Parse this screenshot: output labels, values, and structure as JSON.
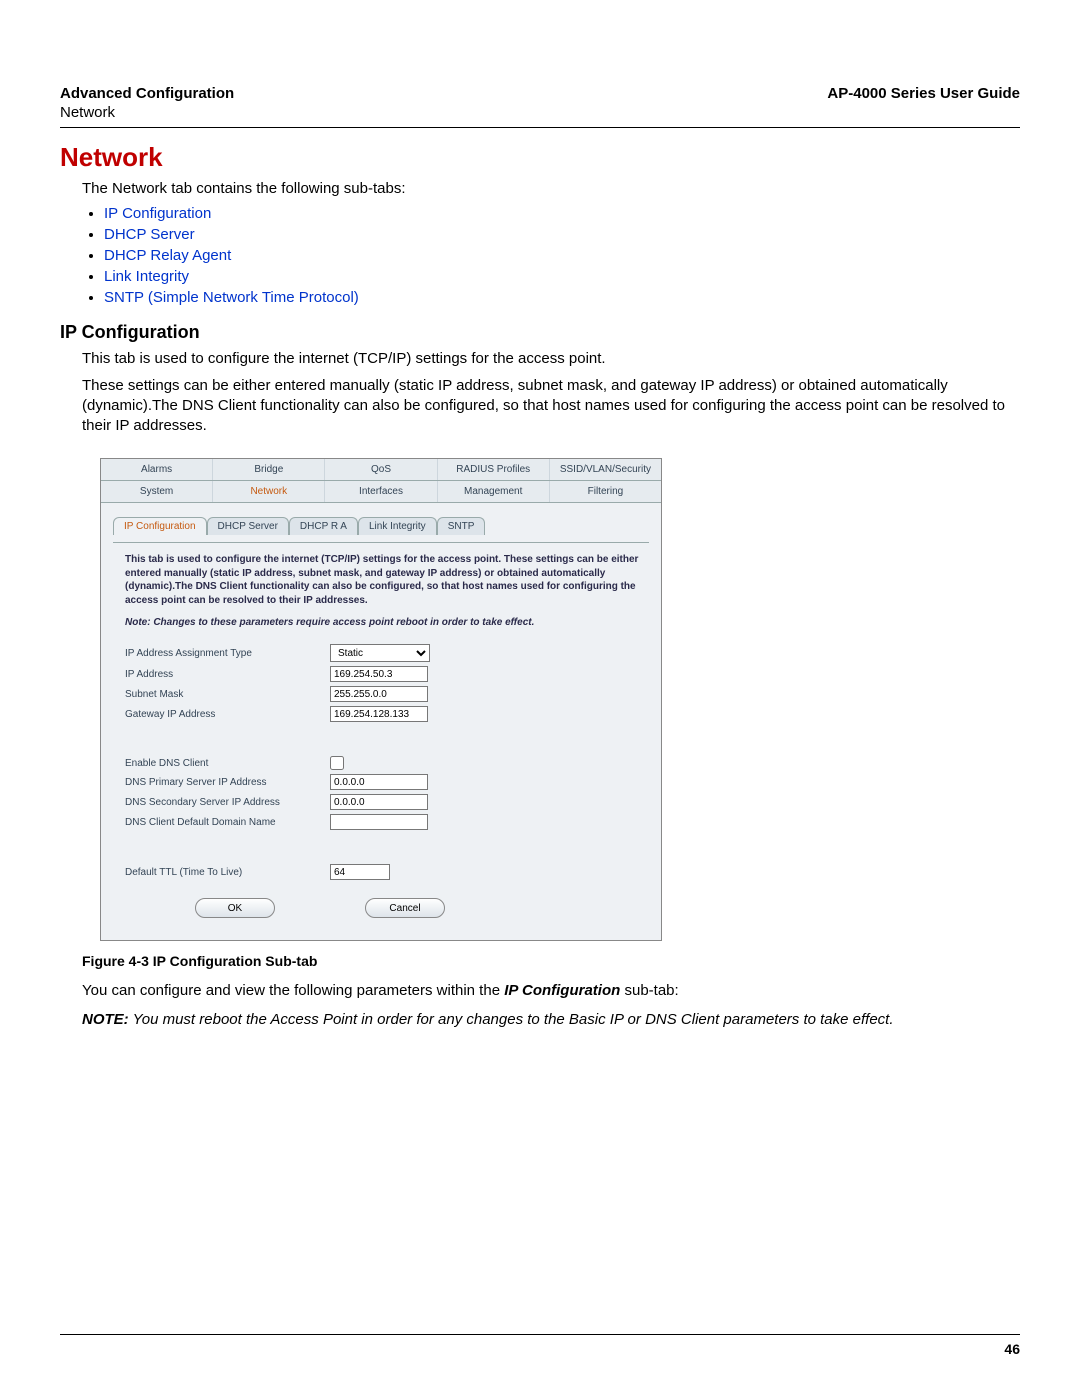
{
  "header": {
    "left_title": "Advanced Configuration",
    "left_sub": "Network",
    "right_title": "AP-4000 Series User Guide"
  },
  "section": {
    "title": "Network",
    "intro": "The Network tab contains the following sub-tabs:",
    "links": [
      "IP Configuration",
      "DHCP Server",
      "DHCP Relay Agent",
      "Link Integrity",
      "SNTP (Simple Network Time Protocol)"
    ]
  },
  "ipconfig": {
    "heading": "IP Configuration",
    "p1": "This tab is used to configure the internet (TCP/IP) settings for the access point.",
    "p2": "These settings can be either entered manually (static IP address, subnet mask, and gateway IP address) or obtained automatically (dynamic).The DNS Client functionality can also be configured, so that host names used for configuring the access point can be resolved to their IP addresses."
  },
  "panel": {
    "top_tabs_row1": [
      "Alarms",
      "Bridge",
      "QoS",
      "RADIUS Profiles",
      "SSID/VLAN/Security"
    ],
    "top_tabs_row2": [
      "System",
      "Network",
      "Interfaces",
      "Management",
      "Filtering"
    ],
    "active_top_tab": "Network",
    "sub_tabs": [
      "IP Configuration",
      "DHCP Server",
      "DHCP R A",
      "Link Integrity",
      "SNTP"
    ],
    "active_sub_tab": "IP Configuration",
    "desc": "This tab is used to configure the internet (TCP/IP) settings for the access point. These settings can be either entered manually (static IP address, subnet mask, and gateway IP address) or obtained automatically (dynamic).The DNS Client functionality can also be configured, so that host names used for configuring the access point can be resolved to their IP addresses.",
    "note": "Note: Changes to these parameters require access point reboot in order to take effect.",
    "fields": {
      "ip_assignment_label": "IP Address Assignment Type",
      "ip_assignment_value": "Static",
      "ip_address_label": "IP Address",
      "ip_address_value": "169.254.50.3",
      "subnet_label": "Subnet Mask",
      "subnet_value": "255.255.0.0",
      "gateway_label": "Gateway IP Address",
      "gateway_value": "169.254.128.133",
      "enable_dns_label": "Enable DNS Client",
      "dns_primary_label": "DNS Primary Server IP Address",
      "dns_primary_value": "0.0.0.0",
      "dns_secondary_label": "DNS Secondary Server IP Address",
      "dns_secondary_value": "0.0.0.0",
      "dns_domain_label": "DNS Client Default Domain Name",
      "dns_domain_value": "",
      "ttl_label": "Default TTL (Time To Live)",
      "ttl_value": "64"
    },
    "buttons": {
      "ok": "OK",
      "cancel": "Cancel"
    }
  },
  "figure_caption": "Figure 4-3 IP Configuration Sub-tab",
  "post_figure": {
    "p1_pre": "You can configure and view the following parameters within the ",
    "p1_strong": "IP Configuration",
    "p1_post": " sub-tab:",
    "note_lead": "NOTE:",
    "note_body": " You must reboot the Access Point in order for any changes to the Basic IP or DNS Client parameters to take effect."
  },
  "page_number": "46"
}
